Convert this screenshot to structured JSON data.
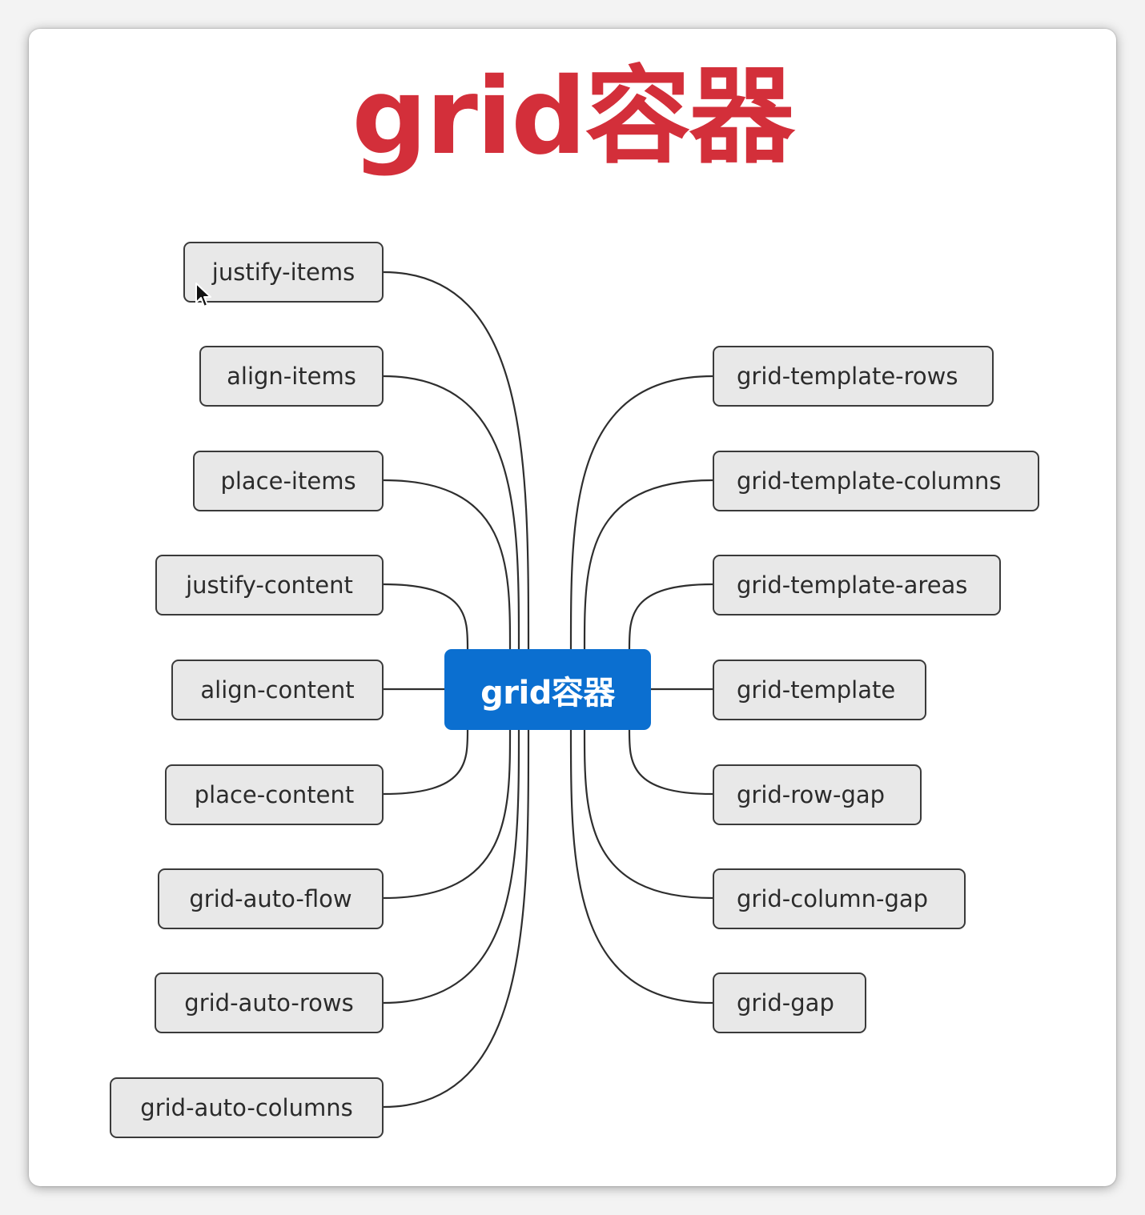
{
  "title": "grid容器",
  "center_label": "grid容器",
  "colors": {
    "title": "#d32f3a",
    "center_fill": "#0b6fd0",
    "node_fill": "#e8e8e8",
    "node_border": "#3a3a3a",
    "connector": "#2e2e2e"
  },
  "left_nodes": [
    "justify-items",
    "align-items",
    "place-items",
    "justify-content",
    "align-content",
    "place-content",
    "grid-auto-flow",
    "grid-auto-rows",
    "grid-auto-columns"
  ],
  "right_nodes": [
    "grid-template-rows",
    "grid-template-columns",
    "grid-template-areas",
    "grid-template",
    "grid-row-gap",
    "grid-column-gap",
    "grid-gap"
  ]
}
